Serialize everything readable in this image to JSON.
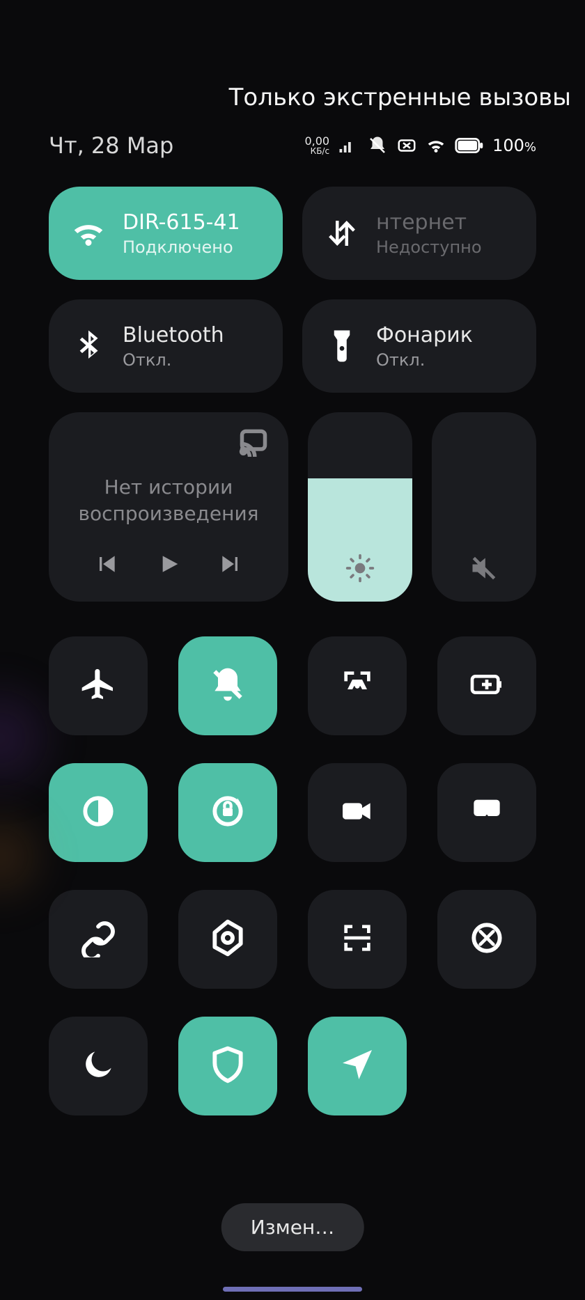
{
  "top_banner": "Только экстренные вызовы",
  "date": "Чт, 28 Мар",
  "status": {
    "net_speed_value": "0,00",
    "net_speed_unit": "КБ/с",
    "battery_pct": "100",
    "pct_sign": "%"
  },
  "tiles": {
    "wifi": {
      "title": "DIR-615-41",
      "sub": "Подключено"
    },
    "data": {
      "title": "нтернет",
      "sub": "Недоступно"
    },
    "bluetooth": {
      "title": "Bluetooth",
      "sub": "Откл."
    },
    "flashlight": {
      "title": "Фонарик",
      "sub": "Откл."
    }
  },
  "media": {
    "message_line1": "Нет истории",
    "message_line2": "воспроизведения"
  },
  "brightness_pct": 65,
  "volume_pct": 0,
  "small_tiles": [
    {
      "name": "airplane-mode",
      "active": false,
      "icon": "airplane"
    },
    {
      "name": "mute",
      "active": true,
      "icon": "bell-slash"
    },
    {
      "name": "screenshot",
      "active": false,
      "icon": "screenshot"
    },
    {
      "name": "battery-saver",
      "active": false,
      "icon": "battery-plus"
    },
    {
      "name": "dark-mode",
      "active": true,
      "icon": "contrast"
    },
    {
      "name": "rotation-lock",
      "active": true,
      "icon": "rotation-lock"
    },
    {
      "name": "screen-record",
      "active": false,
      "icon": "video"
    },
    {
      "name": "cast",
      "active": false,
      "icon": "airplay"
    },
    {
      "name": "link",
      "active": false,
      "icon": "link"
    },
    {
      "name": "settings",
      "active": false,
      "icon": "nut"
    },
    {
      "name": "scan",
      "active": false,
      "icon": "scan"
    },
    {
      "name": "sync",
      "active": false,
      "icon": "sync"
    },
    {
      "name": "do-not-disturb",
      "active": false,
      "icon": "moon"
    },
    {
      "name": "security",
      "active": true,
      "icon": "shield"
    },
    {
      "name": "location",
      "active": true,
      "icon": "location"
    }
  ],
  "edit_button": "Измен…"
}
